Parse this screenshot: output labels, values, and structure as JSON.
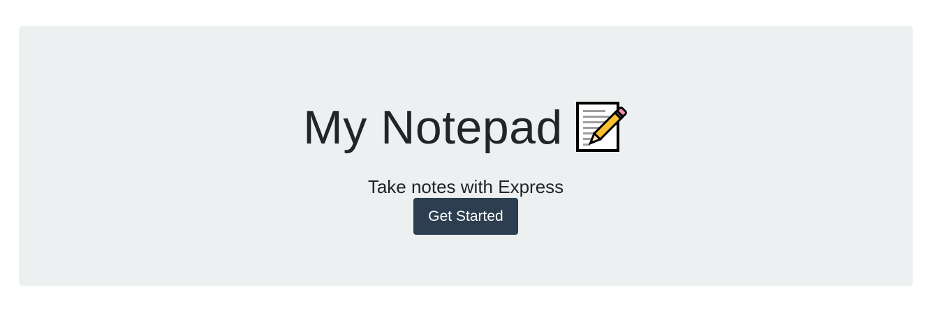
{
  "hero": {
    "title": "My Notepad",
    "title_icon": "memo-icon",
    "subtitle": "Take notes with Express",
    "button_label": "Get Started"
  },
  "colors": {
    "background": "#ffffff",
    "jumbotron": "#ecf0f1",
    "button": "#2c3e50",
    "text": "#212529"
  }
}
